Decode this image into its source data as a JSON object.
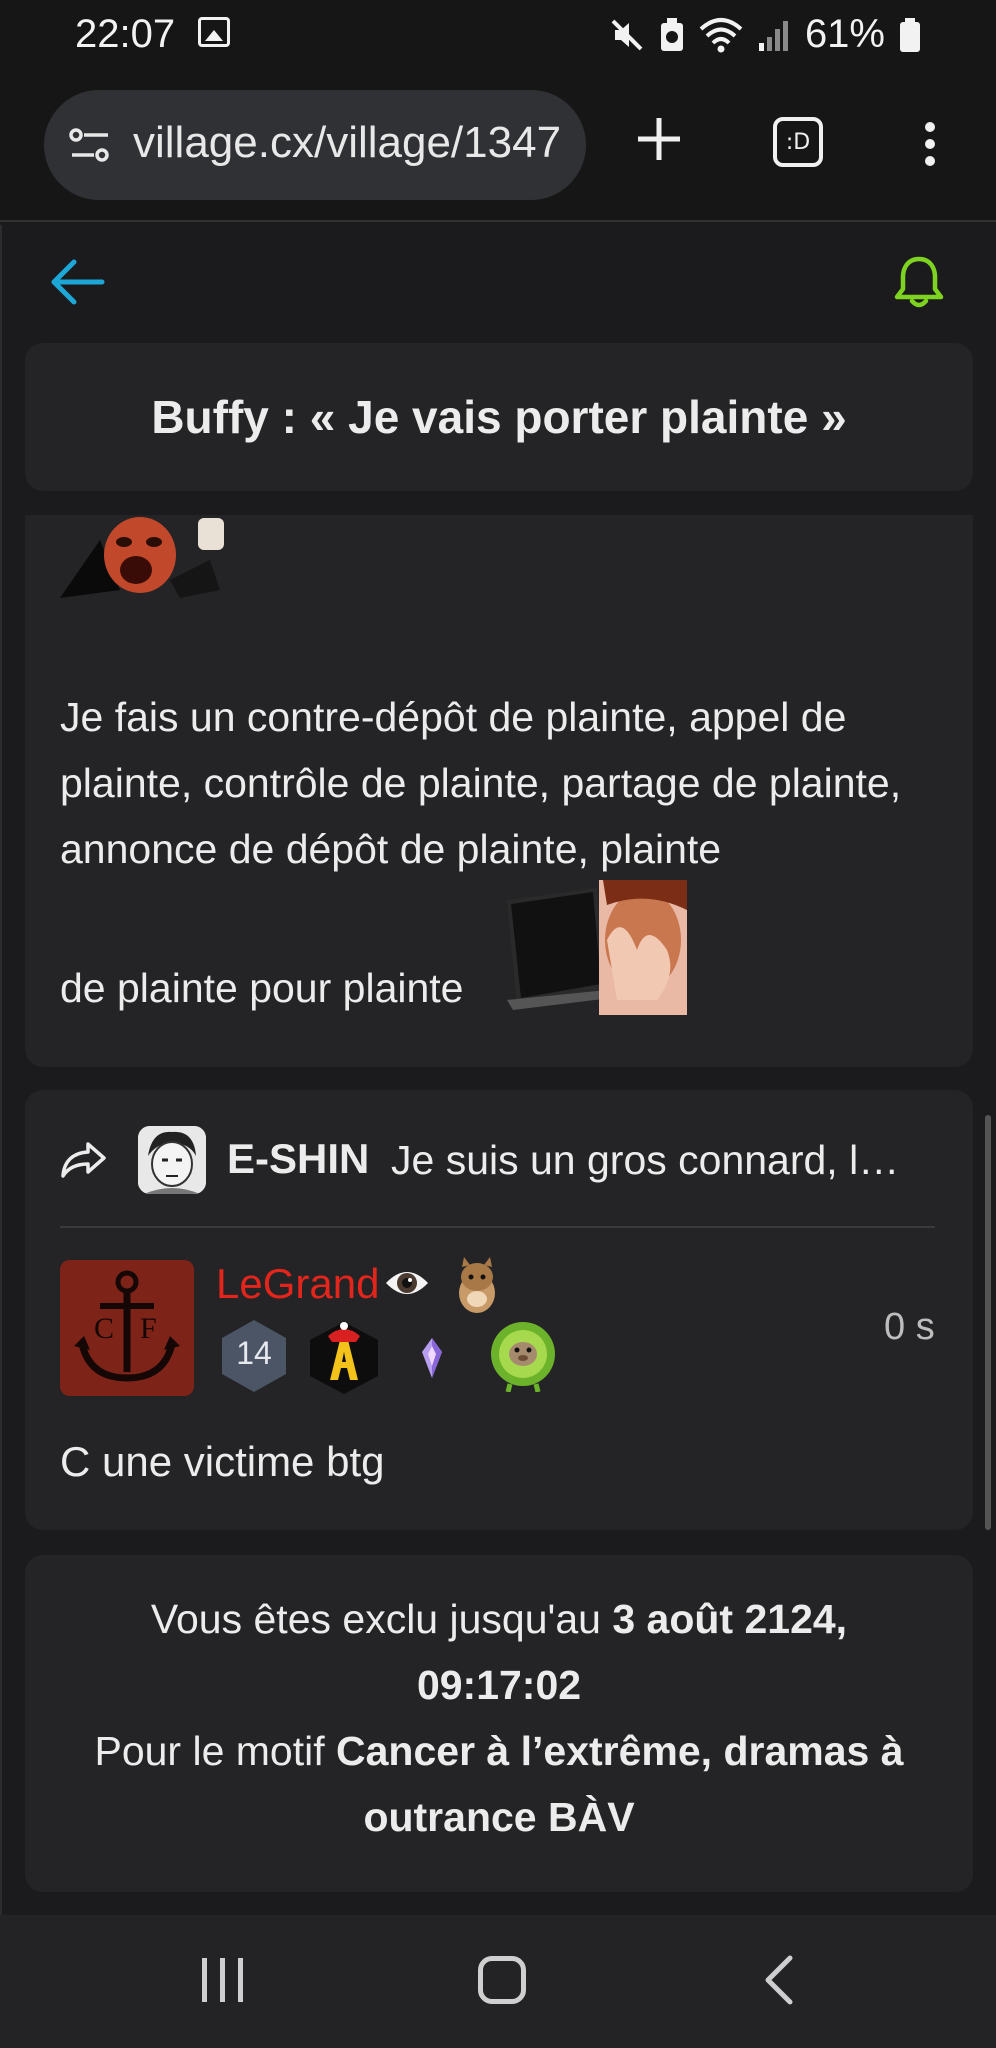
{
  "status_bar": {
    "time": "22:07",
    "battery": "61%",
    "icons": [
      "image-icon",
      "mute-icon",
      "battery-saver-icon",
      "wifi-icon",
      "signal-icon",
      "battery-icon"
    ]
  },
  "browser": {
    "url": "village.cx/village/1347",
    "tabs_label": ":D",
    "icons": [
      "site-settings-icon",
      "new-tab-plus-icon",
      "tab-switcher-icon",
      "overflow-menu-icon"
    ]
  },
  "header": {
    "back_icon": "back-arrow-icon",
    "notify_icon": "bell-icon",
    "colors": {
      "back": "#1da7d6",
      "bell": "#7ed321"
    }
  },
  "topic": {
    "title": "Buffy : « Je vais porter plainte »"
  },
  "post": {
    "body": "Je fais un contre-dépôt de plainte, appel de plainte, contrôle de plainte, partage de plainte, annonce de dépôt de plainte, plainte",
    "last_line": "de plainte pour plainte",
    "stickers": [
      "screaming-face-sticker",
      "laptop-facepalm-sticker"
    ]
  },
  "reply": {
    "quote": {
      "author": "E-SHIN",
      "text": "Je suis un gros connard, l…"
    },
    "author": {
      "name": "LeGrand",
      "name_color": "#e3251c",
      "level": "14",
      "badges": [
        "eye-icon",
        "hamster-icon",
        "gold-a-badge",
        "crystal-badge",
        "kiwi-badge"
      ]
    },
    "time": "0 s",
    "text": "C une victime btg"
  },
  "ban_notice": {
    "line1_prefix": "Vous êtes exclu jusqu'au ",
    "line1_date": "3 août 2124,",
    "line2_time": "09:17:02",
    "line3_prefix": "Pour le motif ",
    "line3_reason": "Cancer à l’extrême, dramas à",
    "line4_reason": "outrance BÀV"
  },
  "nav_bar": {
    "icons": [
      "recent-apps-icon",
      "home-icon",
      "back-nav-icon"
    ]
  }
}
